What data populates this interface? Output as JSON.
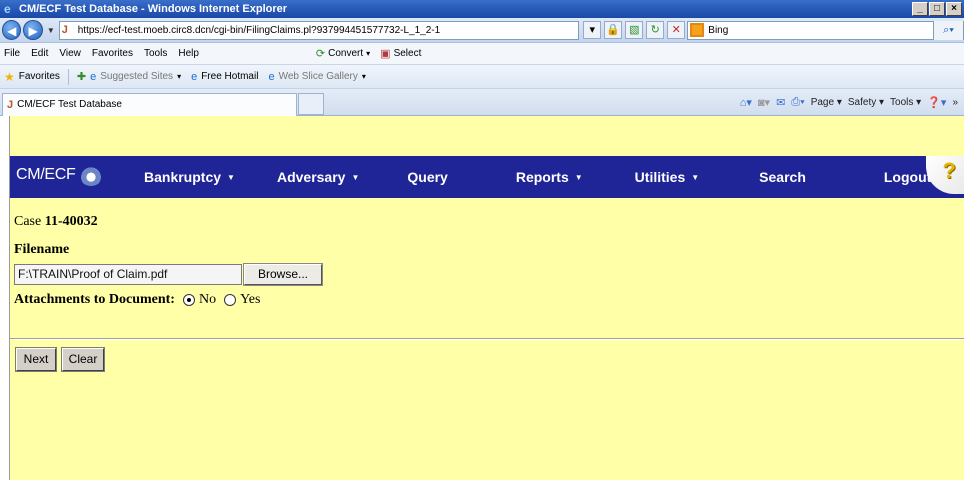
{
  "window": {
    "title": "CM/ECF Test Database - Windows Internet Explorer",
    "controls": [
      "_",
      "□",
      "×"
    ]
  },
  "address_bar": {
    "url": "https://ecf-test.moeb.circ8.dcn/cgi-bin/FilingClaims.pl?937994451577732-L_1_2-1",
    "search_text": "Bing"
  },
  "menu": {
    "file": "File",
    "edit": "Edit",
    "view": "View",
    "favorites": "Favorites",
    "tools": "Tools",
    "help": "Help",
    "convert": "Convert",
    "select": "Select"
  },
  "favorites_bar": {
    "favorites": "Favorites",
    "suggested_sites": "Suggested Sites",
    "free_hotmail": "Free Hotmail",
    "web_slice_gallery": "Web Slice Gallery"
  },
  "tab": {
    "title": "CM/ECF Test Database"
  },
  "command_bar": {
    "page": "Page",
    "safety": "Safety",
    "tools": "Tools"
  },
  "cmecf": {
    "logo": "CM/ECF",
    "nav": {
      "bankruptcy": "Bankruptcy",
      "adversary": "Adversary",
      "query": "Query",
      "reports": "Reports",
      "utilities": "Utilities",
      "search": "Search",
      "logout": "Logout"
    },
    "help_symbol": "?"
  },
  "form": {
    "case_prefix": "Case ",
    "case_number": "11-40032",
    "filename_label": "Filename",
    "filename_value": "F:\\TRAIN\\Proof of Claim.pdf",
    "browse_label": "Browse...",
    "attachments_label": "Attachments to Document:",
    "radio_no": "No",
    "radio_yes": "Yes",
    "selected": "No",
    "next_label": "Next",
    "clear_label": "Clear"
  }
}
